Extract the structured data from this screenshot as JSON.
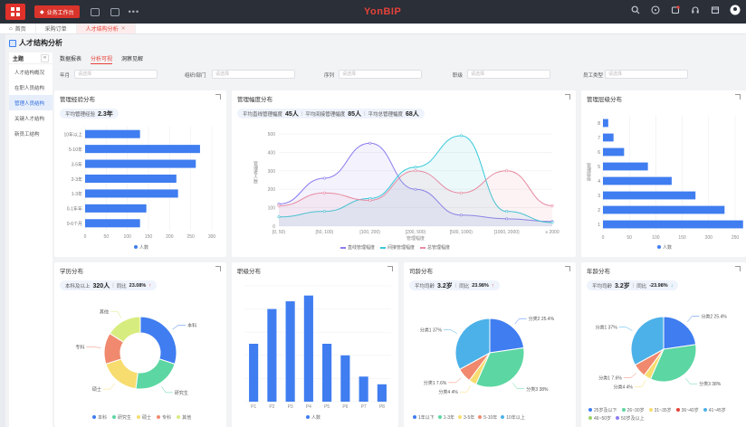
{
  "topbar": {
    "workspace": "业务工作台",
    "brand": "YonBIP"
  },
  "tabs": [
    {
      "label": "首页"
    },
    {
      "label": "采购订单"
    },
    {
      "label": "人才结构分析"
    }
  ],
  "page": {
    "title": "人才结构分析"
  },
  "sidebar": {
    "header": "主题",
    "items": [
      "人才结构概况",
      "在职人员结构",
      "管理人员结构",
      "关键人才结构",
      "新员工结构"
    ],
    "active_index": 2
  },
  "subtabs": [
    "数据报表",
    "分析可视",
    "洞察见解"
  ],
  "filters": [
    {
      "label": "年月",
      "placeholder": "请选择"
    },
    {
      "label": "组织/部门",
      "placeholder": "请选择"
    },
    {
      "label": "序列",
      "placeholder": "请选择"
    },
    {
      "label": "职级",
      "placeholder": "请选择"
    },
    {
      "label": "员工类型",
      "placeholder": "请选择"
    }
  ],
  "colors": {
    "blue": "#3f7df0",
    "red": "#e64238",
    "teal": "#37c8d8",
    "purple": "#8b7cf0",
    "pink": "#e88aa0"
  },
  "cards": {
    "exp": {
      "title": "管理经验分布",
      "stat_label": "平均管理经验",
      "stat_value": "2.3年",
      "legend": "人数",
      "chart_data": {
        "type": "bar",
        "categories": [
          "10年以上",
          "5-10年",
          "3-5年",
          "2-3年",
          "1-3年",
          "0-1年年",
          "0-6个月"
        ],
        "values": [
          130,
          272,
          262,
          216,
          220,
          145,
          130
        ],
        "xlim": [
          0,
          300
        ],
        "xticks": [
          "0",
          "50",
          "100",
          "150",
          "200",
          "250",
          "300"
        ]
      }
    },
    "span": {
      "title": "管理幅度分布",
      "stat": [
        {
          "label": "平均直线管理幅度",
          "value": "45人"
        },
        {
          "label": "平均间接管理幅度",
          "value": "85人"
        },
        {
          "label": "平均总管理幅度",
          "value": "68人"
        }
      ],
      "ylabel": "管理者人数",
      "xlabel": "管理幅度",
      "chart_data": {
        "type": "line",
        "categories": [
          "[0, 50)",
          "[50, 100)",
          "[100, 200)",
          "[200, 500)",
          "[500, 1000)",
          "[1000, 2000)",
          "≥ 2000"
        ],
        "ylim": [
          0,
          500
        ],
        "yticks": [
          "0",
          "100",
          "200",
          "300",
          "400",
          "500"
        ],
        "series": [
          {
            "name": "直线管理幅度",
            "values": [
              120,
              260,
              450,
              200,
              60,
              40,
              25
            ]
          },
          {
            "name": "间接管理幅度",
            "values": [
              50,
              80,
              150,
              320,
              490,
              80,
              20
            ]
          },
          {
            "name": "总管理幅度",
            "values": [
              110,
              180,
              140,
              300,
              180,
              300,
              110
            ]
          }
        ]
      }
    },
    "level": {
      "title": "管理层级分布",
      "ylabel": "管理层级",
      "legend": "人数",
      "chart_data": {
        "type": "bar",
        "categories": [
          "8",
          "7",
          "6",
          "5",
          "4",
          "3",
          "2",
          "1"
        ],
        "values": [
          10,
          20,
          40,
          85,
          130,
          175,
          230,
          265
        ],
        "xlim": [
          0,
          250
        ],
        "xticks": [
          "0",
          "50",
          "100",
          "150",
          "200",
          "250"
        ]
      }
    },
    "edu": {
      "title": "学历分布",
      "stat_label": "本科及以上",
      "stat_value": "320人",
      "yoy_label": "同比",
      "yoy_value": "23.08%",
      "chart_data": {
        "type": "pie",
        "categories": [
          "本科",
          "研究生",
          "硕士",
          "专科",
          "其他"
        ],
        "values": [
          30,
          22,
          18,
          14,
          16
        ],
        "labels": [
          "本科",
          "研究生",
          "硕士",
          "专科",
          "其他"
        ]
      }
    },
    "rank": {
      "title": "职级分布",
      "legend": "人数",
      "chart_data": {
        "type": "bar",
        "categories": [
          "P1",
          "P2",
          "P3",
          "P4",
          "P5",
          "P6",
          "P7",
          "P8"
        ],
        "values": [
          150,
          240,
          260,
          275,
          150,
          120,
          65,
          45
        ],
        "ylim": [
          0,
          300
        ]
      }
    },
    "tenure": {
      "title": "司龄分布",
      "stat_label": "平均司龄",
      "stat_value": "3.2岁",
      "yoy_label": "同比",
      "yoy_value": "23.98%",
      "legend": [
        "1年以下",
        "1-3年",
        "3-5年",
        "5-10年",
        "10年以上"
      ],
      "chart_data": {
        "type": "pie",
        "categories": [
          "分类2",
          "分类3",
          "分类4",
          "分类1.6",
          "分类1"
        ],
        "values": [
          25.4,
          38,
          4,
          7.6,
          37
        ],
        "labels": [
          "分类2 25.4%",
          "分类3 38%",
          "分类4 4%",
          "分类1 7.6%",
          "分类1 37%"
        ]
      }
    },
    "age": {
      "title": "年龄分布",
      "stat_label": "平均司龄",
      "stat_value": "3.2岁",
      "yoy_label": "同比",
      "yoy_value": "-23.98%",
      "legend": [
        "25岁及以下",
        "26~30岁",
        "31~35岁",
        "36~40岁",
        "41~45岁",
        "46~50岁",
        "50岁及以上"
      ],
      "chart_data": {
        "type": "pie",
        "categories": [
          "分类2",
          "分类3",
          "分类4",
          "分类1.6",
          "分类1"
        ],
        "values": [
          25.4,
          38,
          4,
          7.6,
          37
        ],
        "labels": [
          "分类2 25.4%",
          "分类3 38%",
          "分类4 4%",
          "分类1 7.6%",
          "分类1 37%"
        ]
      }
    }
  }
}
